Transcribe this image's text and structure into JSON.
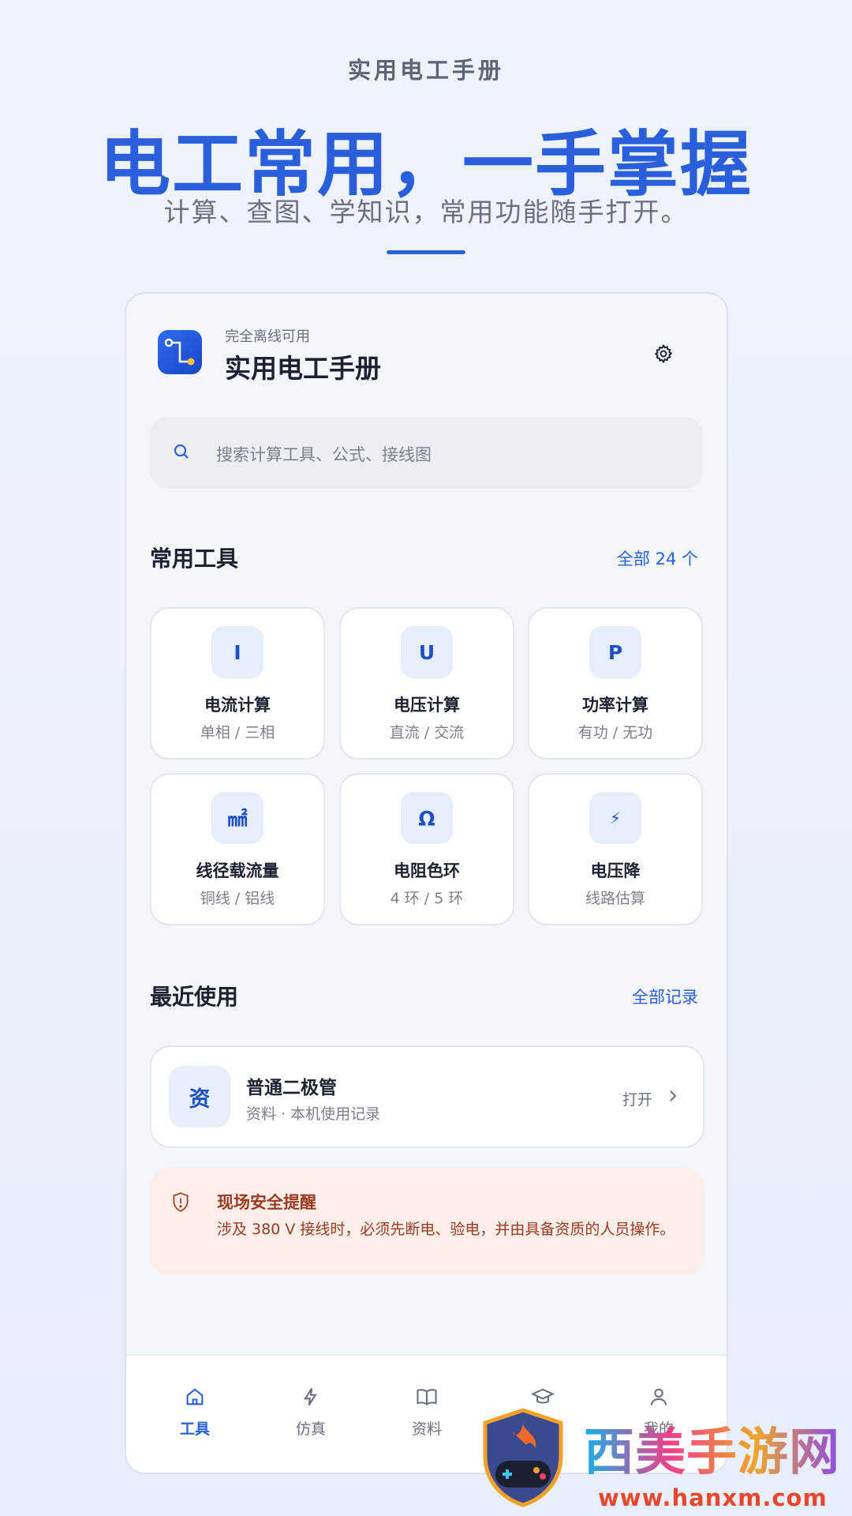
{
  "hero": {
    "label": "实用电工手册",
    "title": "电工常用，一手掌握",
    "subtitle": "计算、查图、学知识，常用功能随手打开。"
  },
  "app": {
    "tagline": "完全离线可用",
    "title": "实用电工手册",
    "logo_icon": "circuit-logo-icon",
    "settings_icon": "gear-icon"
  },
  "search": {
    "placeholder": "搜索计算工具、公式、接线图"
  },
  "tools_section": {
    "title": "常用工具",
    "link": "全部 24 个",
    "items": [
      {
        "symbol": "I",
        "name": "电流计算",
        "sub": "单相 / 三相"
      },
      {
        "symbol": "U",
        "name": "电压计算",
        "sub": "直流 / 交流"
      },
      {
        "symbol": "P",
        "name": "功率计算",
        "sub": "有功 / 无功"
      },
      {
        "symbol": "㎟",
        "name": "线径载流量",
        "sub": "铜线 / 铝线"
      },
      {
        "symbol": "Ω",
        "name": "电阻色环",
        "sub": "4 环 / 5 环"
      },
      {
        "symbol": "⚡",
        "name": "电压降",
        "sub": "线路估算"
      }
    ]
  },
  "recent_section": {
    "title": "最近使用",
    "link": "全部记录",
    "item": {
      "icon_text": "资",
      "title": "普通二极管",
      "meta": "资料 · 本机使用记录",
      "action": "打开"
    }
  },
  "safety": {
    "title": "现场安全提醒",
    "body": "涉及 380 V 接线时，必须先断电、验电，并由具备资质的人员操作。"
  },
  "tabs": [
    {
      "label": "工具",
      "icon": "home-icon",
      "active": true
    },
    {
      "label": "仿真",
      "icon": "lightning-icon",
      "active": false
    },
    {
      "label": "资料",
      "icon": "book-icon",
      "active": false
    },
    {
      "label": "",
      "icon": "graduation-cap-icon",
      "active": false
    },
    {
      "label": "我的",
      "icon": "user-icon",
      "active": false
    }
  ],
  "watermark": {
    "brand": "西美手游网",
    "url": "www.hanxm.com"
  },
  "colors": {
    "accent": "#2a5fdc",
    "warning_bg": "#fcefea",
    "warning_text": "#9a3a22"
  }
}
